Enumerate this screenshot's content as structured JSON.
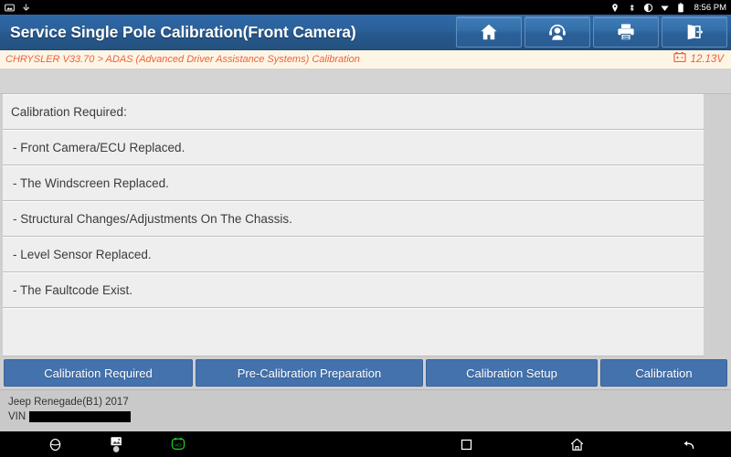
{
  "statusbar": {
    "left_icons": [
      "screenshot-icon",
      "usb-icon"
    ],
    "right_icons": [
      "location-icon",
      "bluetooth-icon",
      "brightness-icon",
      "download-icon",
      "battery-icon"
    ],
    "time": "8:56 PM"
  },
  "titlebar": {
    "title": "Service Single Pole Calibration(Front Camera)",
    "buttons": [
      {
        "name": "home-button",
        "icon": "home-icon"
      },
      {
        "name": "support-button",
        "icon": "headset-user-icon"
      },
      {
        "name": "print-button",
        "icon": "printer-icon"
      },
      {
        "name": "exit-button",
        "icon": "exit-icon"
      }
    ]
  },
  "breadcrumb": {
    "text": "CHRYSLER V33.70 > ADAS (Advanced Driver Assistance Systems) Calibration",
    "voltage": "12.13V",
    "voltage_icon": "battery-voltage-icon",
    "accent_color": "#f0603c"
  },
  "content": {
    "header": "Calibration Required:",
    "items": [
      "- Front Camera/ECU Replaced.",
      "- The Windscreen Replaced.",
      "- Structural Changes/Adjustments On The Chassis.",
      "- Level Sensor Replaced.",
      "- The Faultcode Exist."
    ]
  },
  "tabs": [
    {
      "label": "Calibration Required",
      "name": "tab-calibration-required"
    },
    {
      "label": "Pre-Calibration Preparation",
      "name": "tab-pre-calibration-preparation"
    },
    {
      "label": "Calibration Setup",
      "name": "tab-calibration-setup"
    },
    {
      "label": "Calibration",
      "name": "tab-calibration"
    }
  ],
  "footer": {
    "vehicle": "Jeep Renegade(B1) 2017",
    "vin_label": "VIN",
    "vin_value": ""
  },
  "navbar": {
    "left_icons": [
      "browser-icon",
      "screenshot-icon",
      "vci-icon"
    ],
    "right_icons": [
      "recents-icon",
      "home-icon",
      "back-icon"
    ]
  },
  "colors": {
    "title_blue": "#2a6098",
    "tab_blue": "#4472ad",
    "accent_orange": "#f0603c",
    "vci_green": "#23c723"
  }
}
